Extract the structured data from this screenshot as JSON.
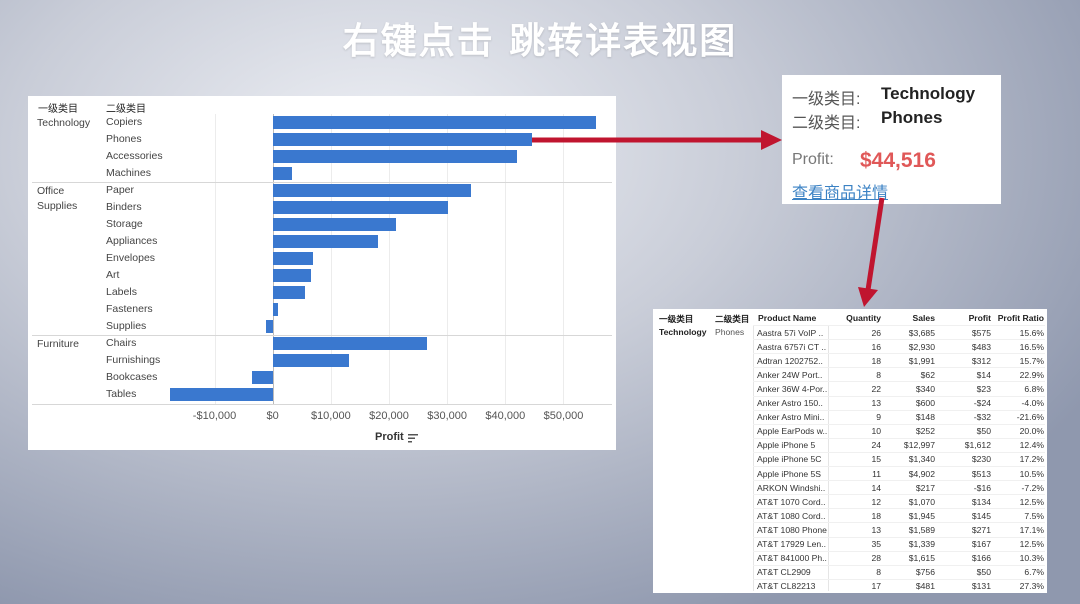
{
  "title": "右键点击  跳转详表视图",
  "chart": {
    "col_headers": [
      "一级类目",
      "二级类目"
    ],
    "axis_title": "Profit",
    "sort_icon": "sort-descending-icon",
    "bar_color": "#3a78cf",
    "groups": [
      {
        "label": "Technology",
        "items": [
          {
            "name": "Copiers",
            "value": 55618
          },
          {
            "name": "Phones",
            "value": 44516
          },
          {
            "name": "Accessories",
            "value": 41937
          },
          {
            "name": "Machines",
            "value": 3385
          }
        ]
      },
      {
        "label": "Office Supplies",
        "items": [
          {
            "name": "Paper",
            "value": 34054
          },
          {
            "name": "Binders",
            "value": 30222
          },
          {
            "name": "Storage",
            "value": 21279
          },
          {
            "name": "Appliances",
            "value": 18138
          },
          {
            "name": "Envelopes",
            "value": 6964
          },
          {
            "name": "Art",
            "value": 6528
          },
          {
            "name": "Labels",
            "value": 5546
          },
          {
            "name": "Fasteners",
            "value": 950
          },
          {
            "name": "Supplies",
            "value": -1189
          }
        ]
      },
      {
        "label": "Furniture",
        "items": [
          {
            "name": "Chairs",
            "value": 26590
          },
          {
            "name": "Furnishings",
            "value": 13059
          },
          {
            "name": "Bookcases",
            "value": -3473
          },
          {
            "name": "Tables",
            "value": -17725
          }
        ]
      }
    ],
    "ticks": [
      "-$10,000",
      "$0",
      "$10,000",
      "$20,000",
      "$30,000",
      "$40,000",
      "$50,000"
    ],
    "tick_values": [
      -10000,
      0,
      10000,
      20000,
      30000,
      40000,
      50000
    ],
    "xlim": [
      -18000,
      58000
    ]
  },
  "tooltip": {
    "l1_label": "一级类目:",
    "l1_value": "Technology",
    "l2_label": "二级类目:",
    "l2_value": "Phones",
    "profit_label": "Profit:",
    "profit_value": "$44,516",
    "profit_color": "#e05858",
    "link": "查看商品详情"
  },
  "detail": {
    "headers": [
      "一级类目",
      "二级类目",
      "Product Name",
      "Quantity",
      "Sales",
      "Profit",
      "Profit Ratio"
    ],
    "level1": "Technology",
    "level2": "Phones",
    "rows": [
      [
        "Aastra 57i VoIP ..",
        "26",
        "$3,685",
        "$575",
        "15.6%"
      ],
      [
        "Aastra 6757i CT ..",
        "16",
        "$2,930",
        "$483",
        "16.5%"
      ],
      [
        "Adtran 1202752..",
        "18",
        "$1,991",
        "$312",
        "15.7%"
      ],
      [
        "Anker 24W Port..",
        "8",
        "$62",
        "$14",
        "22.9%"
      ],
      [
        "Anker 36W 4-Por..",
        "22",
        "$340",
        "$23",
        "6.8%"
      ],
      [
        "Anker Astro 150..",
        "13",
        "$600",
        "-$24",
        "-4.0%"
      ],
      [
        "Anker Astro Mini..",
        "9",
        "$148",
        "-$32",
        "-21.6%"
      ],
      [
        "Apple EarPods w..",
        "10",
        "$252",
        "$50",
        "20.0%"
      ],
      [
        "Apple iPhone 5",
        "24",
        "$12,997",
        "$1,612",
        "12.4%"
      ],
      [
        "Apple iPhone 5C",
        "15",
        "$1,340",
        "$230",
        "17.2%"
      ],
      [
        "Apple iPhone 5S",
        "11",
        "$4,902",
        "$513",
        "10.5%"
      ],
      [
        "ARKON Windshi..",
        "14",
        "$217",
        "-$16",
        "-7.2%"
      ],
      [
        "AT&T 1070 Cord..",
        "12",
        "$1,070",
        "$134",
        "12.5%"
      ],
      [
        "AT&T 1080 Cord..",
        "18",
        "$1,945",
        "$145",
        "7.5%"
      ],
      [
        "AT&T 1080 Phone",
        "13",
        "$1,589",
        "$271",
        "17.1%"
      ],
      [
        "AT&T 17929 Len..",
        "35",
        "$1,339",
        "$167",
        "12.5%"
      ],
      [
        "AT&T 841000 Ph..",
        "28",
        "$1,615",
        "$166",
        "10.3%"
      ],
      [
        "AT&T CL2909",
        "8",
        "$756",
        "$50",
        "6.7%"
      ],
      [
        "AT&T CL82213",
        "17",
        "$481",
        "$131",
        "27.3%"
      ]
    ]
  },
  "arrow_color": "#c0152f"
}
